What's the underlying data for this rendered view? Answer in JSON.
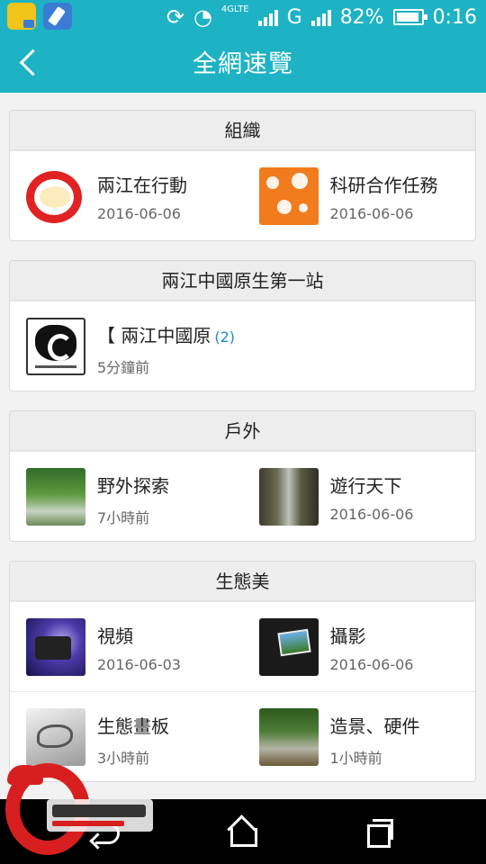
{
  "status_bar": {
    "network_label": "4GLTE",
    "carrier_g": "G",
    "battery_percent": "82%",
    "time": "0:16"
  },
  "app_bar": {
    "title": "全網速覽"
  },
  "sections": [
    {
      "title": "組織",
      "items": [
        {
          "title": "兩江在行動",
          "time": "2016-06-06",
          "thumb": "org-logo-red"
        },
        {
          "title": "科研合作任務",
          "time": "2016-06-06",
          "thumb": "orange-network"
        }
      ]
    },
    {
      "title": "兩江中國原生第一站",
      "items": [
        {
          "title": "【 兩江中國原",
          "badge": "(2)",
          "time": "5分鐘前",
          "thumb": "c-logo"
        }
      ]
    },
    {
      "title": "戶外",
      "items": [
        {
          "title": "野外探索",
          "time": "7小時前",
          "thumb": "forest-stream"
        },
        {
          "title": "遊行天下",
          "time": "2016-06-06",
          "thumb": "cliff-valley"
        }
      ]
    },
    {
      "title": "生態美",
      "items": [
        {
          "title": "視頻",
          "time": "2016-06-03",
          "thumb": "video-camera"
        },
        {
          "title": "攝影",
          "time": "2016-06-06",
          "thumb": "photo-camera"
        },
        {
          "title": "生態畫板",
          "time": "3小時前",
          "thumb": "fish-sketch"
        },
        {
          "title": "造景、硬件",
          "time": "1小時前",
          "thumb": "aquascape"
        }
      ]
    }
  ],
  "colors": {
    "accent": "#1db3c4",
    "badge": "#1a8bd1",
    "watermark_red": "#d81f1f"
  }
}
